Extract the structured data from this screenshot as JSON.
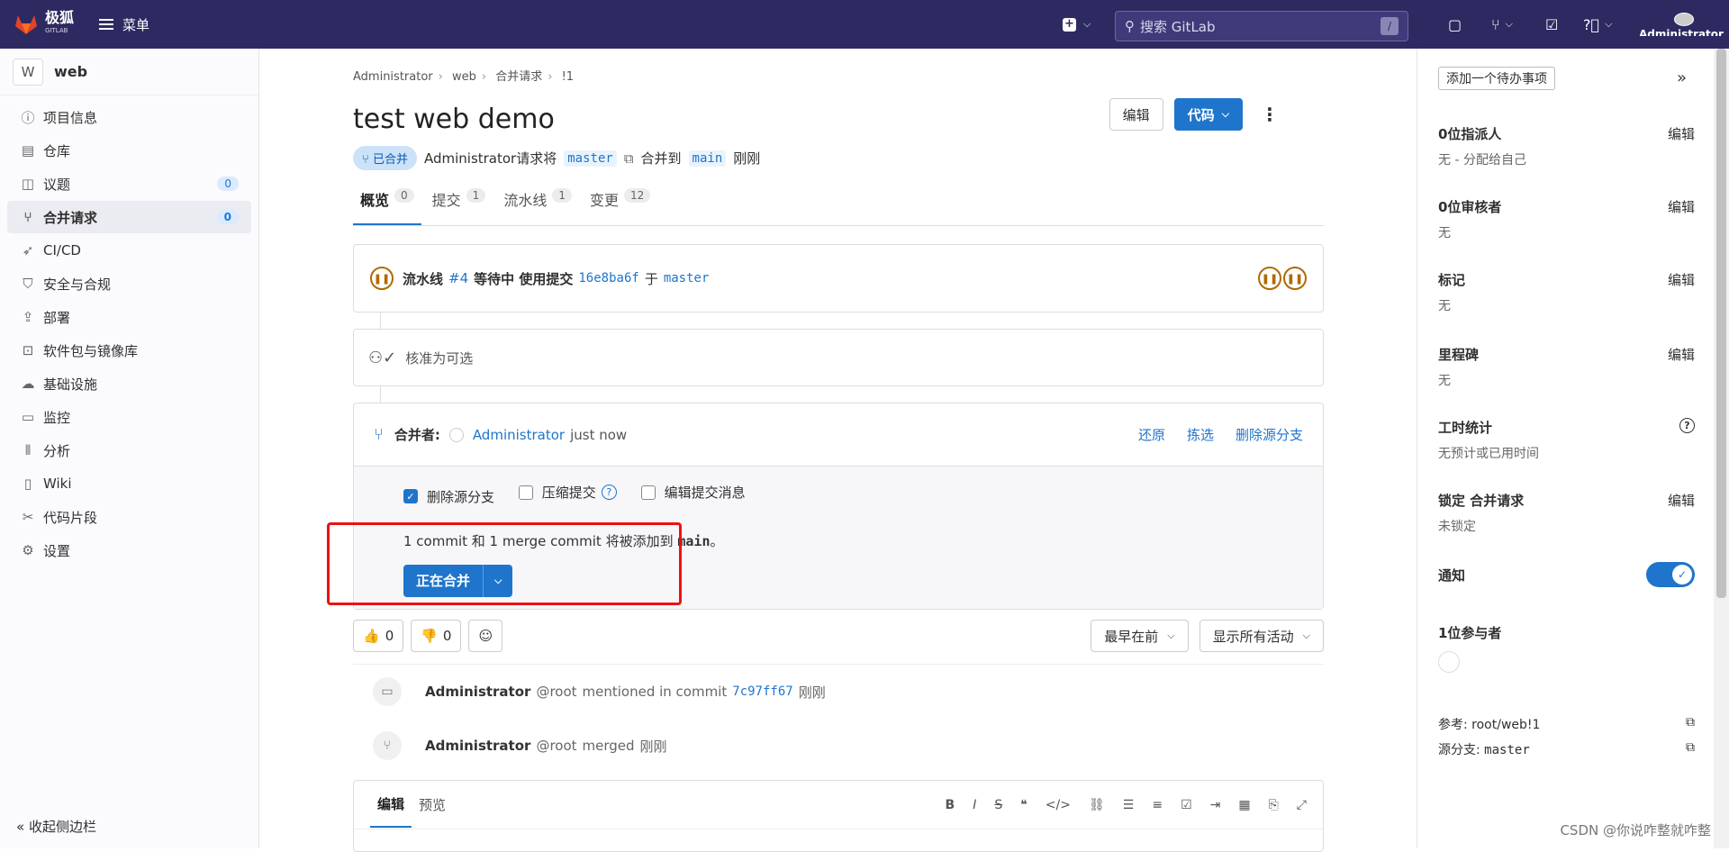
{
  "topbar": {
    "logo_text": "极狐",
    "logo_sub": "GITLAB",
    "menu_label": "菜单",
    "search_placeholder": "搜索 GitLab",
    "search_shortcut": "/",
    "user_label": "Administrator"
  },
  "sidebar": {
    "project_initial": "W",
    "project_name": "web",
    "items": [
      {
        "label": "项目信息",
        "icon": "info-icon"
      },
      {
        "label": "仓库",
        "icon": "document-icon"
      },
      {
        "label": "议题",
        "icon": "issues-icon",
        "count": "0"
      },
      {
        "label": "合并请求",
        "icon": "merge-request-icon",
        "count": "0"
      },
      {
        "label": "CI/CD",
        "icon": "rocket-icon"
      },
      {
        "label": "安全与合规",
        "icon": "shield-icon"
      },
      {
        "label": "部署",
        "icon": "deployments-icon"
      },
      {
        "label": "软件包与镜像库",
        "icon": "package-icon"
      },
      {
        "label": "基础设施",
        "icon": "cloud-icon"
      },
      {
        "label": "监控",
        "icon": "monitor-icon"
      },
      {
        "label": "分析",
        "icon": "chart-icon"
      },
      {
        "label": "Wiki",
        "icon": "book-icon"
      },
      {
        "label": "代码片段",
        "icon": "snippet-icon"
      },
      {
        "label": "设置",
        "icon": "settings-icon"
      }
    ],
    "collapse_label": "收起侧边栏"
  },
  "breadcrumb": [
    "Administrator",
    "web",
    "合并请求",
    "!1"
  ],
  "mr": {
    "title": "test web demo",
    "edit_label": "编辑",
    "code_label": "代码",
    "status_badge": "已合并",
    "author_text": "Administrator请求将",
    "source_branch": "master",
    "merge_into": "合并到",
    "target_branch": "main",
    "time": "刚刚"
  },
  "tabs": [
    {
      "label": "概览",
      "count": "0"
    },
    {
      "label": "提交",
      "count": "1"
    },
    {
      "label": "流水线",
      "count": "1"
    },
    {
      "label": "变更",
      "count": "12"
    }
  ],
  "pipeline": {
    "prefix": "流水线",
    "id": "#4",
    "status": "等待中 使用提交",
    "commit": "16e8ba6f",
    "on": "于",
    "branch": "master"
  },
  "approval": {
    "text": "核准为可选"
  },
  "merged": {
    "label": "合并者:",
    "user": "Administrator",
    "time": "just now",
    "revert": "还原",
    "cherry_pick": "拣选",
    "delete_branch": "删除源分支",
    "opt_delete": "删除源分支",
    "opt_squash": "压缩提交",
    "opt_edit_msg": "编辑提交消息",
    "note_prefix": "1 commit 和 1 merge commit 将被添加到",
    "note_branch": "main",
    "note_suffix": "。",
    "merge_button": "正在合并"
  },
  "reactions": {
    "thumbs_up": "0",
    "thumbs_down": "0",
    "sort_label": "最早在前",
    "filter_label": "显示所有活动"
  },
  "activity": [
    {
      "user": "Administrator",
      "handle": "@root",
      "text": "mentioned in commit",
      "commit": "7c97ff67",
      "time": "刚刚"
    },
    {
      "user": "Administrator",
      "handle": "@root",
      "text": "merged",
      "time": "刚刚"
    }
  ],
  "editor": {
    "write_tab": "编辑",
    "preview_tab": "预览"
  },
  "right": {
    "todo": "添加一个待办事项",
    "sections": [
      {
        "title": "0位指派人",
        "edit": "编辑",
        "value": "无 - 分配给自己"
      },
      {
        "title": "0位审核者",
        "edit": "编辑",
        "value": "无"
      },
      {
        "title": "标记",
        "edit": "编辑",
        "value": "无"
      },
      {
        "title": "里程碑",
        "edit": "编辑",
        "value": "无"
      },
      {
        "title": "工时统计",
        "edit": "",
        "value": "无预计或已用时间"
      },
      {
        "title": "锁定 合并请求",
        "edit": "编辑",
        "value": "未锁定"
      }
    ],
    "notify_label": "通知",
    "participants": "1位参与者",
    "reference": "参考: root/web!1",
    "source_branch_label": "源分支:",
    "source_branch_value": "master"
  },
  "watermark": "CSDN @你说咋整就咋整",
  "colors": {
    "topbar": "#2d2a62",
    "accent": "#1f75cb",
    "highlight_box": "#e11111",
    "pipeline_pending": "#b06a00"
  }
}
